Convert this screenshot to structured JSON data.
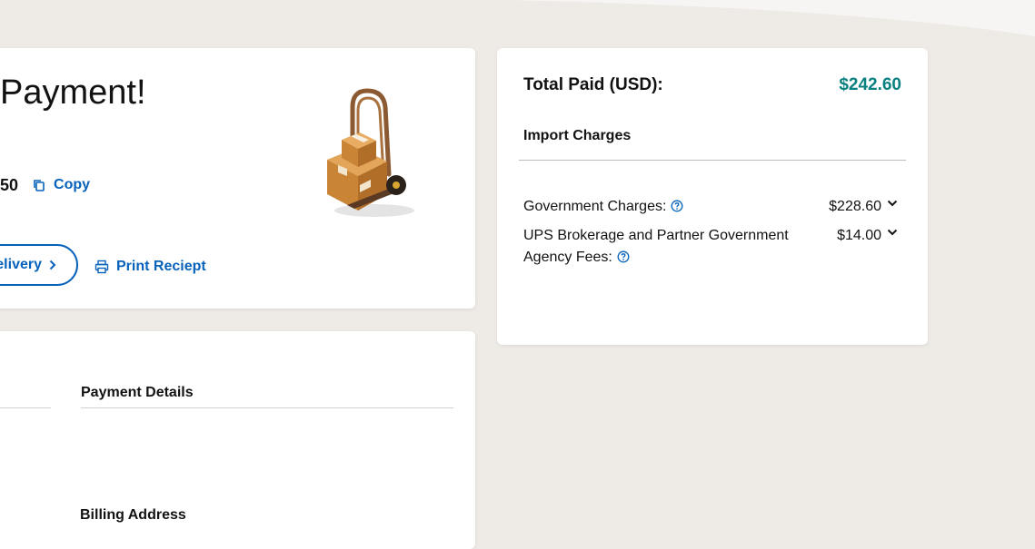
{
  "confirmation": {
    "headline": "Payment!",
    "tracking_number_tail": "50",
    "copy_label": "Copy",
    "delivery_button_label": "elivery",
    "print_label": "Print Reciept"
  },
  "details": {
    "payment_details_title": "Payment Details",
    "billing_address_title": "Billing Address"
  },
  "summary": {
    "total_label": "Total Paid (USD):",
    "total_value": "$242.60",
    "import_charges_title": "Import Charges",
    "charges": [
      {
        "label": "Government Charges:",
        "amount": "$228.60"
      },
      {
        "label": "UPS Brokerage and Partner Government Agency Fees:",
        "amount": "$14.00"
      }
    ]
  },
  "icons": {
    "copy": "copy-icon",
    "print": "printer-icon",
    "help": "question-circle-icon",
    "chevron_down": "chevron-down-icon",
    "chevron_right": "chevron-right-icon",
    "illustration": "hand-truck-boxes-illustration"
  },
  "colors": {
    "accent_blue": "#0662bb",
    "total_teal": "#0a8080",
    "background": "#eeeae6"
  }
}
